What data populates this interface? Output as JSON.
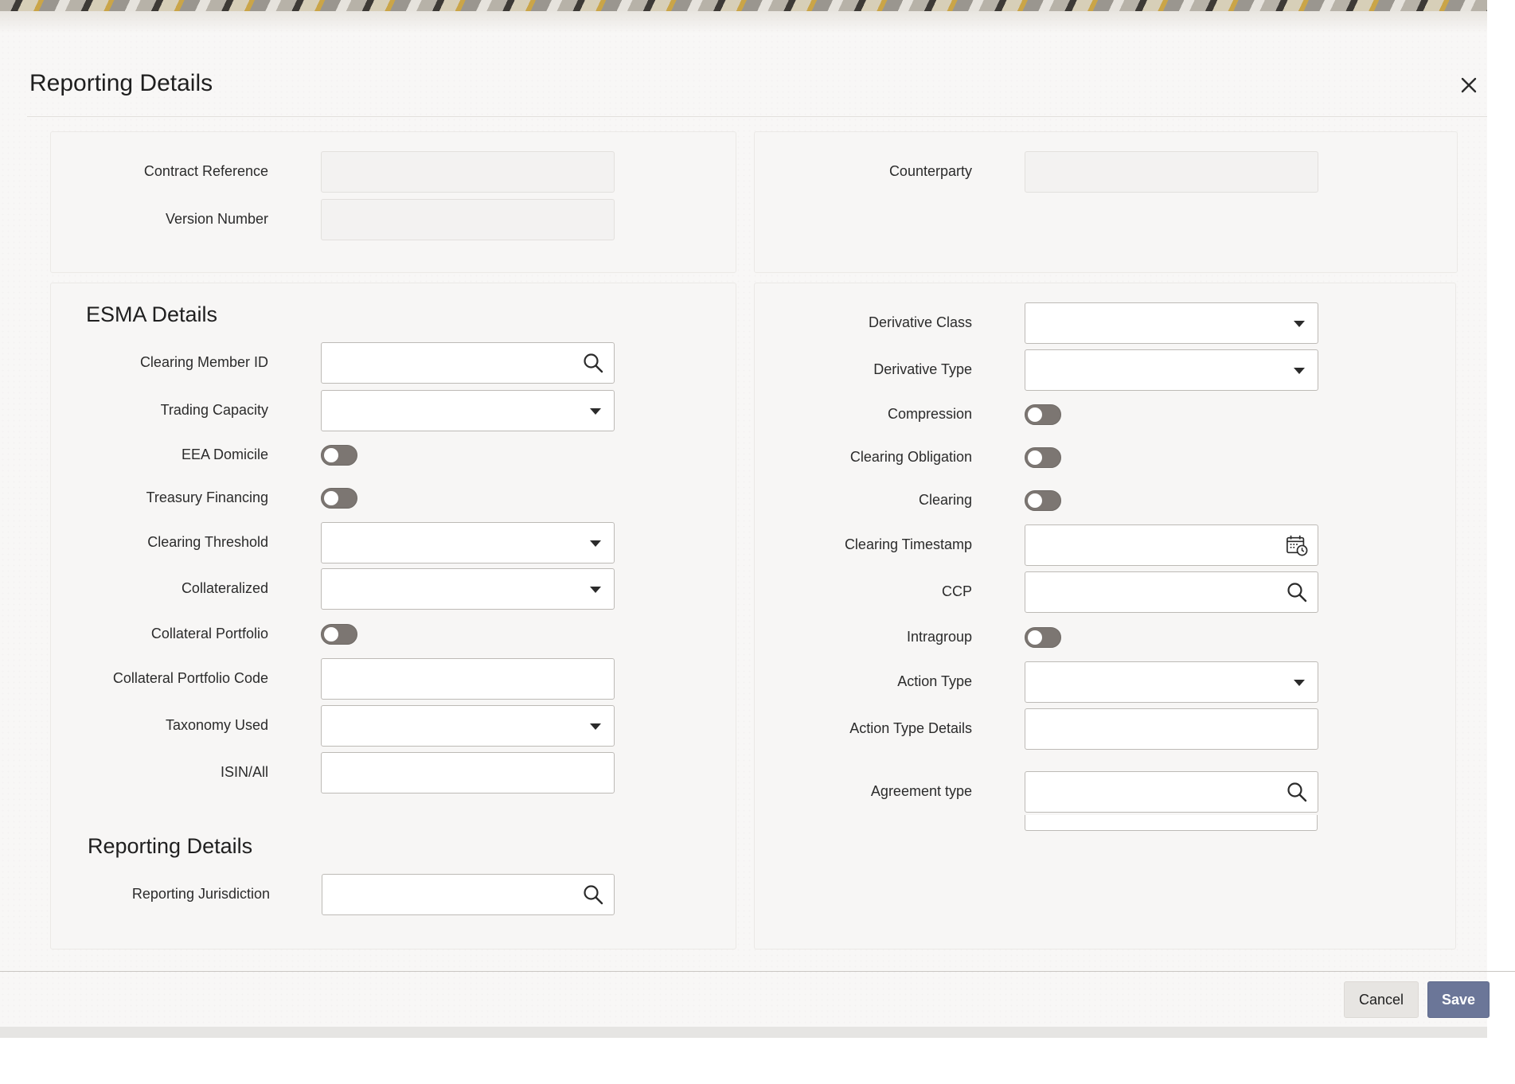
{
  "dialog": {
    "title": "Reporting Details"
  },
  "header_fields": {
    "contract_reference": {
      "label": "Contract Reference",
      "value": ""
    },
    "version_number": {
      "label": "Version Number",
      "value": ""
    },
    "counterparty": {
      "label": "Counterparty",
      "value": ""
    }
  },
  "esma": {
    "title": "ESMA Details",
    "clearing_member_id": {
      "label": "Clearing Member ID",
      "value": ""
    },
    "trading_capacity": {
      "label": "Trading Capacity",
      "value": ""
    },
    "eea_domicile": {
      "label": "EEA Domicile",
      "on": false
    },
    "treasury_financing": {
      "label": "Treasury Financing",
      "on": false
    },
    "clearing_threshold": {
      "label": "Clearing Threshold",
      "value": ""
    },
    "collateralized": {
      "label": "Collateralized",
      "value": ""
    },
    "collateral_portfolio": {
      "label": "Collateral Portfolio",
      "on": false
    },
    "collateral_portfolio_code": {
      "label": "Collateral Portfolio Code",
      "value": ""
    },
    "taxonomy_used": {
      "label": "Taxonomy Used",
      "value": ""
    },
    "isin_all": {
      "label": "ISIN/All",
      "value": ""
    }
  },
  "reporting": {
    "title": "Reporting Details",
    "reporting_jurisdiction": {
      "label": "Reporting Jurisdiction",
      "value": ""
    }
  },
  "right": {
    "derivative_class": {
      "label": "Derivative Class",
      "value": ""
    },
    "derivative_type": {
      "label": "Derivative Type",
      "value": ""
    },
    "compression": {
      "label": "Compression",
      "on": false
    },
    "clearing_obligation": {
      "label": "Clearing Obligation",
      "on": false
    },
    "clearing": {
      "label": "Clearing",
      "on": false
    },
    "clearing_timestamp": {
      "label": "Clearing Timestamp",
      "value": ""
    },
    "ccp": {
      "label": "CCP",
      "value": ""
    },
    "intragroup": {
      "label": "Intragroup",
      "on": false
    },
    "action_type": {
      "label": "Action Type",
      "value": ""
    },
    "action_type_details": {
      "label": "Action Type Details",
      "value": ""
    },
    "agreement_type": {
      "label": "Agreement type",
      "value": ""
    }
  },
  "footer": {
    "cancel_label": "Cancel",
    "save_label": "Save"
  },
  "icons": {
    "close": "close-icon",
    "search": "search-icon",
    "dropdown": "chevron-down-icon",
    "calendar": "calendar-clock-icon"
  },
  "colors": {
    "save_button": "#6b7698",
    "toggle_off": "#7c7672",
    "panel_bg": "#f7f6f5"
  }
}
